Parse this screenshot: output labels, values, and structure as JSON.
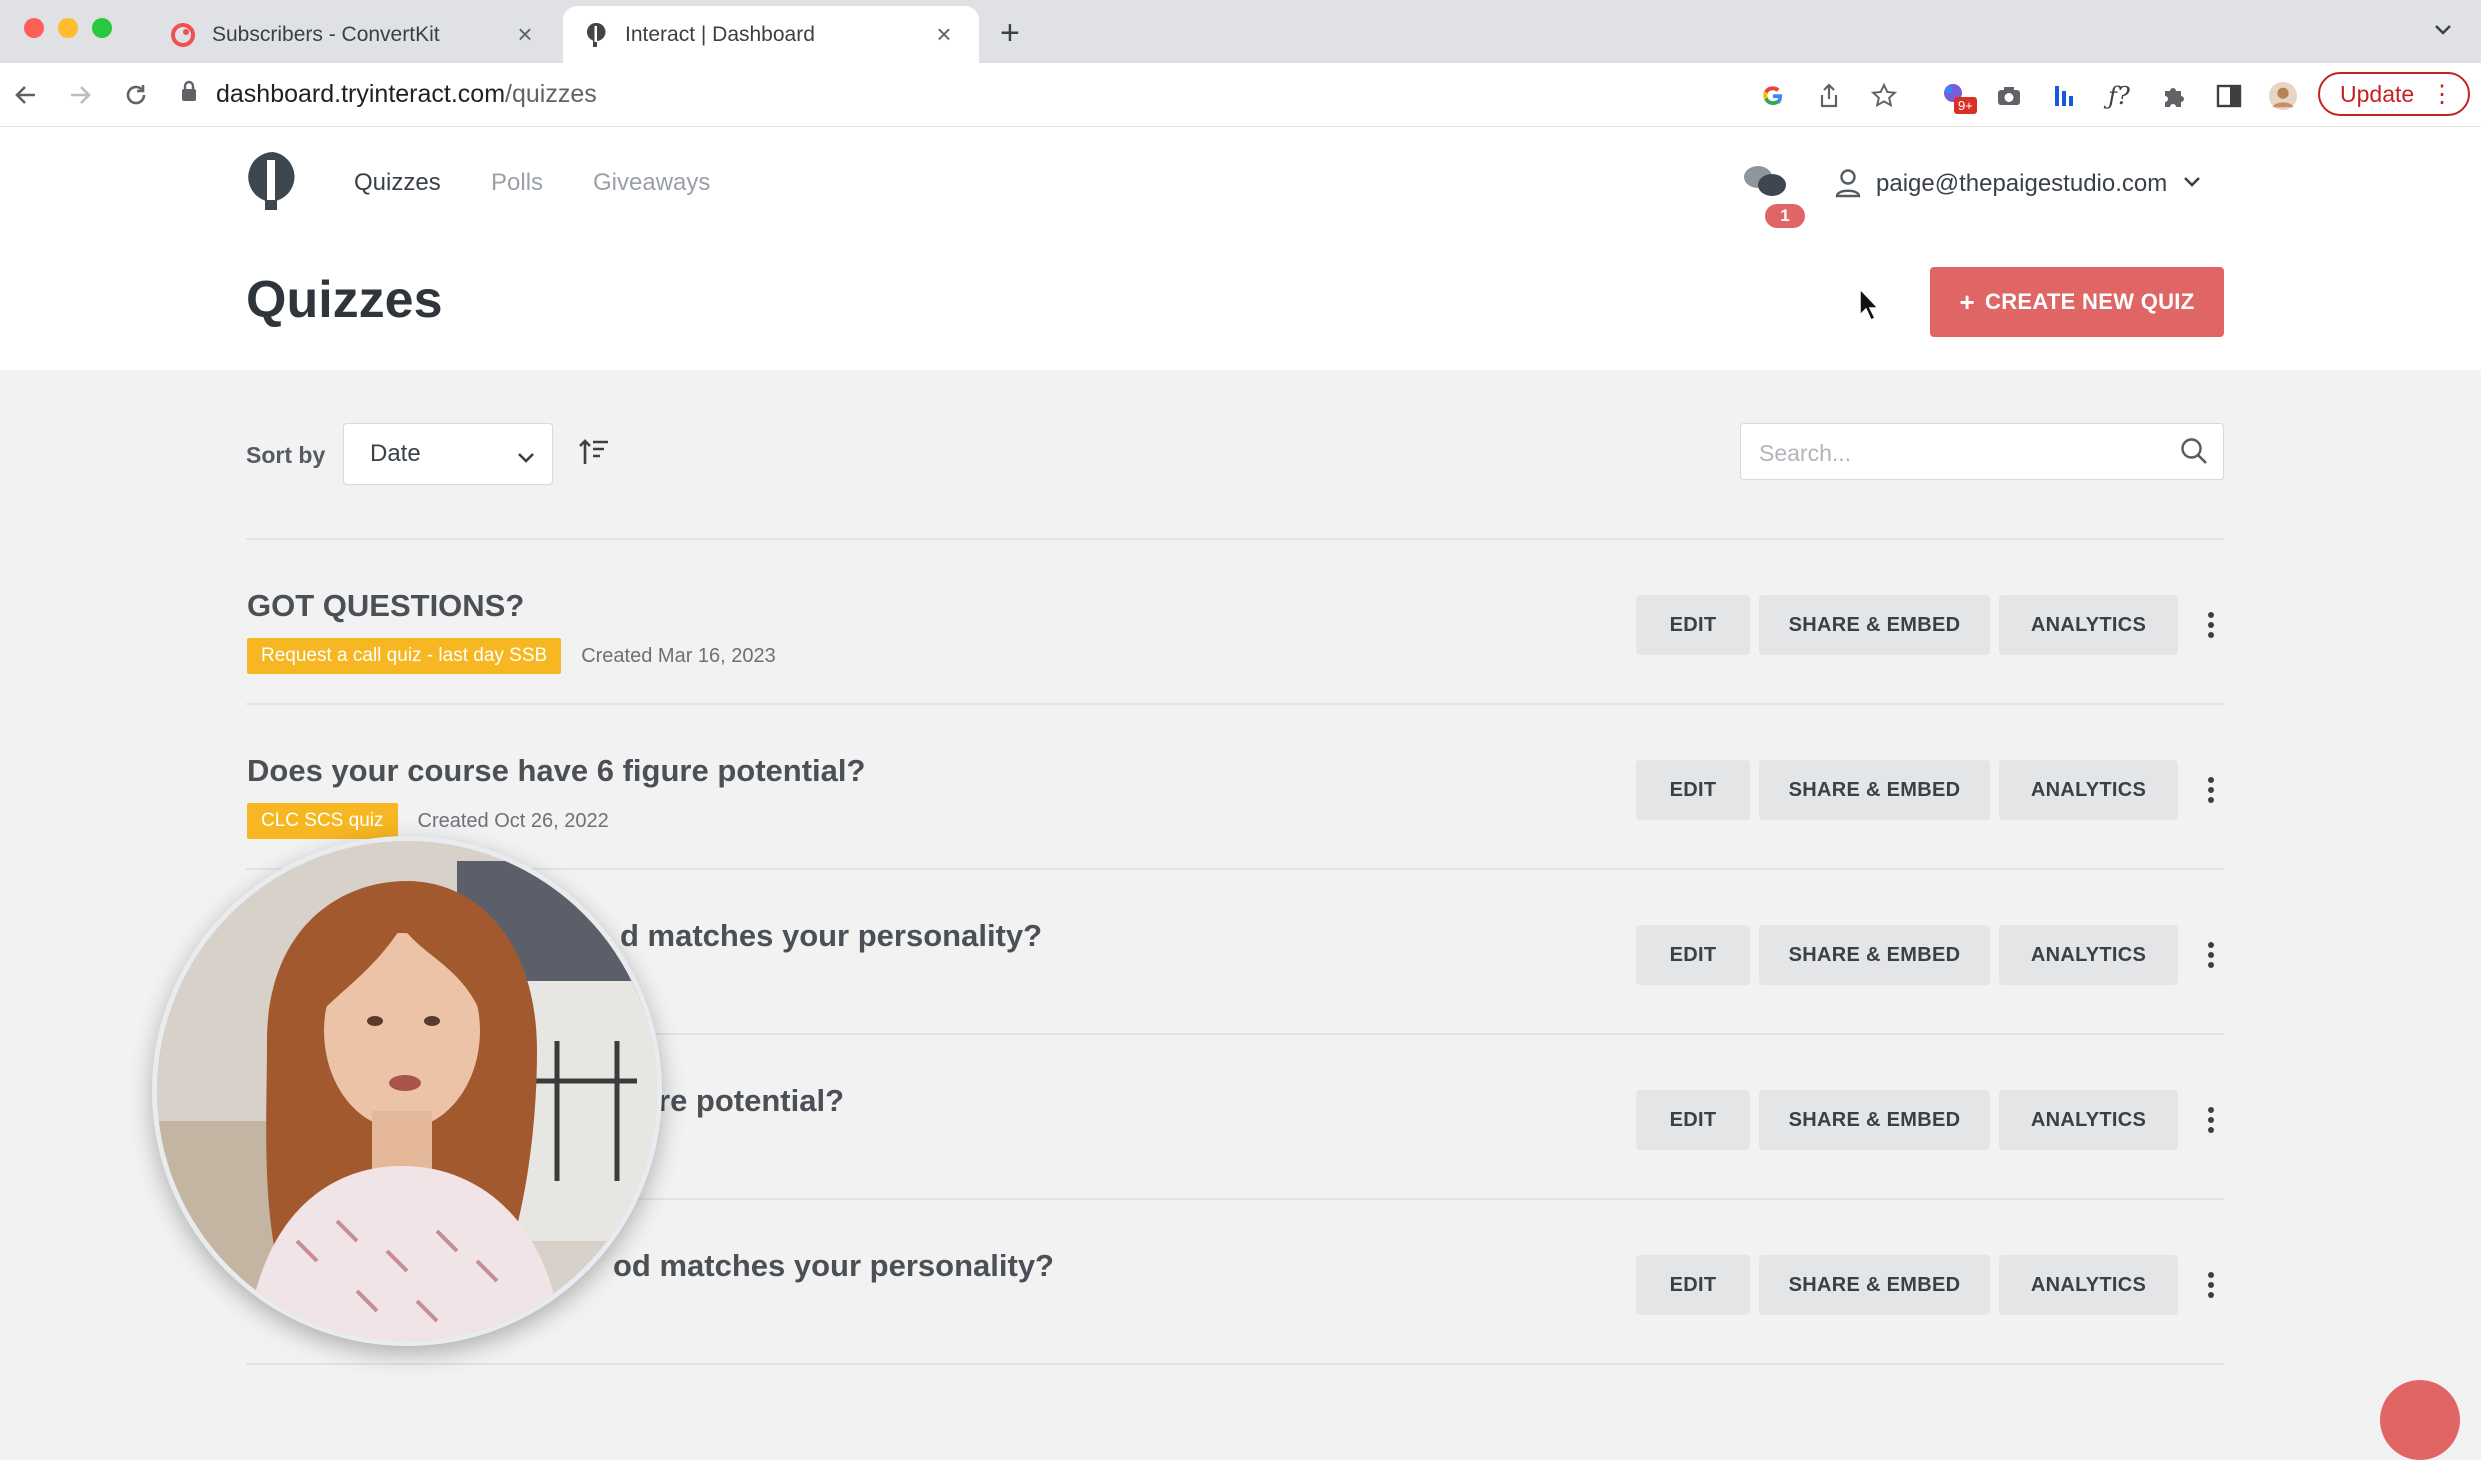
{
  "browser": {
    "tabs": [
      {
        "title": "Subscribers - ConvertKit",
        "active": false
      },
      {
        "title": "Interact | Dashboard",
        "active": true
      }
    ],
    "url_host": "dashboard.tryinteract.com",
    "url_path": "/quizzes",
    "update_label": "Update",
    "extension_badge": "9+"
  },
  "app": {
    "nav": [
      {
        "label": "Quizzes",
        "active": true
      },
      {
        "label": "Polls",
        "active": false
      },
      {
        "label": "Giveaways",
        "active": false
      }
    ],
    "notification_count": "1",
    "user_email": "paige@thepaigestudio.com",
    "page_title": "Quizzes",
    "create_button": "CREATE NEW QUIZ",
    "accent_color": "#e06666",
    "tag_color": "#f6b722"
  },
  "controls": {
    "sort_label": "Sort by",
    "sort_value": "Date",
    "search_placeholder": "Search..."
  },
  "actions": {
    "edit": "EDIT",
    "share": "SHARE & EMBED",
    "analytics": "ANALYTICS"
  },
  "quizzes": [
    {
      "title": "GOT QUESTIONS?",
      "tag": "Request a call quiz - last day SSB",
      "created": "Created Mar 16, 2023"
    },
    {
      "title": "Does your course have 6 figure potential?",
      "tag": "CLC SCS quiz",
      "created": "Created Oct 26, 2022"
    },
    {
      "title": "d matches your personality?",
      "tag": "",
      "created": ""
    },
    {
      "title": "re potential?",
      "tag": "",
      "created": ""
    },
    {
      "title": "od matches your personality?",
      "tag": "",
      "created": ""
    }
  ]
}
